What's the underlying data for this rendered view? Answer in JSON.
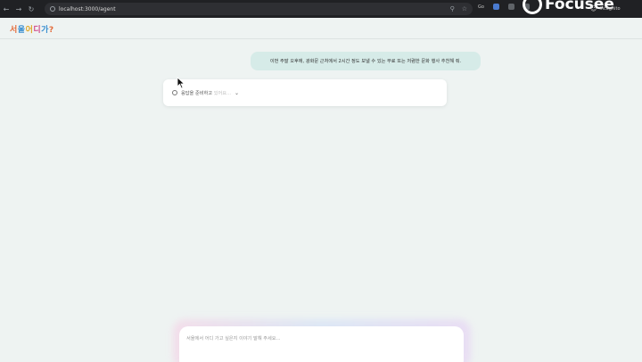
{
  "browser": {
    "url": "localhost:3000/agent",
    "brand": "Focusee",
    "incognito_label": "Incognito",
    "ext_label": "Go"
  },
  "app": {
    "logo_parts": [
      "서",
      "울",
      "어",
      "디",
      "가",
      "?"
    ]
  },
  "chat": {
    "user_message": "이번 주말 오후에, 광화문 근처에서 2시간 정도 보낼 수 있는 무료 또는 저렴한 문화 행사 추천해 줘.",
    "agent_status": "응답을 준비하고 ",
    "agent_status_faded": "있어요..."
  },
  "composer": {
    "placeholder": "서울에서 어디 가고 싶은지 이야기 말해 주세요..."
  }
}
